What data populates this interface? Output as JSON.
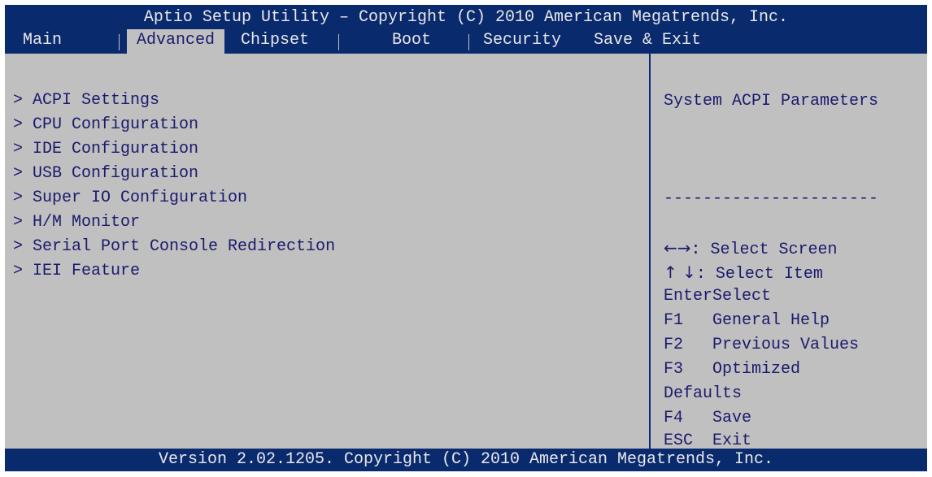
{
  "header": {
    "title": "Aptio Setup Utility – Copyright (C) 2010 American Megatrends, Inc."
  },
  "tabs": [
    {
      "label": "Main"
    },
    {
      "label": "Advanced",
      "active": true
    },
    {
      "label": "Chipset"
    },
    {
      "label": "Boot"
    },
    {
      "label": "Security"
    },
    {
      "label": "Save & Exit"
    }
  ],
  "menu": {
    "items": [
      {
        "label": "> ACPI Settings"
      },
      {
        "label": "> CPU Configuration"
      },
      {
        "label": "> IDE Configuration"
      },
      {
        "label": "> USB Configuration"
      },
      {
        "label": "> Super IO Configuration"
      },
      {
        "label": "> H/M Monitor"
      },
      {
        "label": "> Serial Port Console Redirection"
      },
      {
        "label": "> IEI Feature"
      }
    ]
  },
  "help": {
    "description": "System ACPI Parameters",
    "separator": "----------------------",
    "keys": [
      {
        "key": "←→",
        "action": ": Select Screen"
      },
      {
        "key": "↑ ↓",
        "action": ": Select Item"
      },
      {
        "key": "Enter",
        "action": "Select"
      },
      {
        "key": "F1",
        "action": "   General Help"
      },
      {
        "key": "F2",
        "action": "   Previous Values"
      },
      {
        "key": "F3",
        "action": "   Optimized"
      },
      {
        "key": "",
        "action": "Defaults"
      },
      {
        "key": "F4",
        "action": "   Save"
      },
      {
        "key": "ESC",
        "action": "  Exit"
      }
    ]
  },
  "footer": {
    "version": "Version 2.02.1205. Copyright (C) 2010 American Megatrends, Inc."
  },
  "colors": {
    "bar_blue": "#0a2a6e",
    "panel_gray": "#c0c0c0",
    "text_navy": "#1a1a6e",
    "text_light": "#e8e8e8"
  }
}
